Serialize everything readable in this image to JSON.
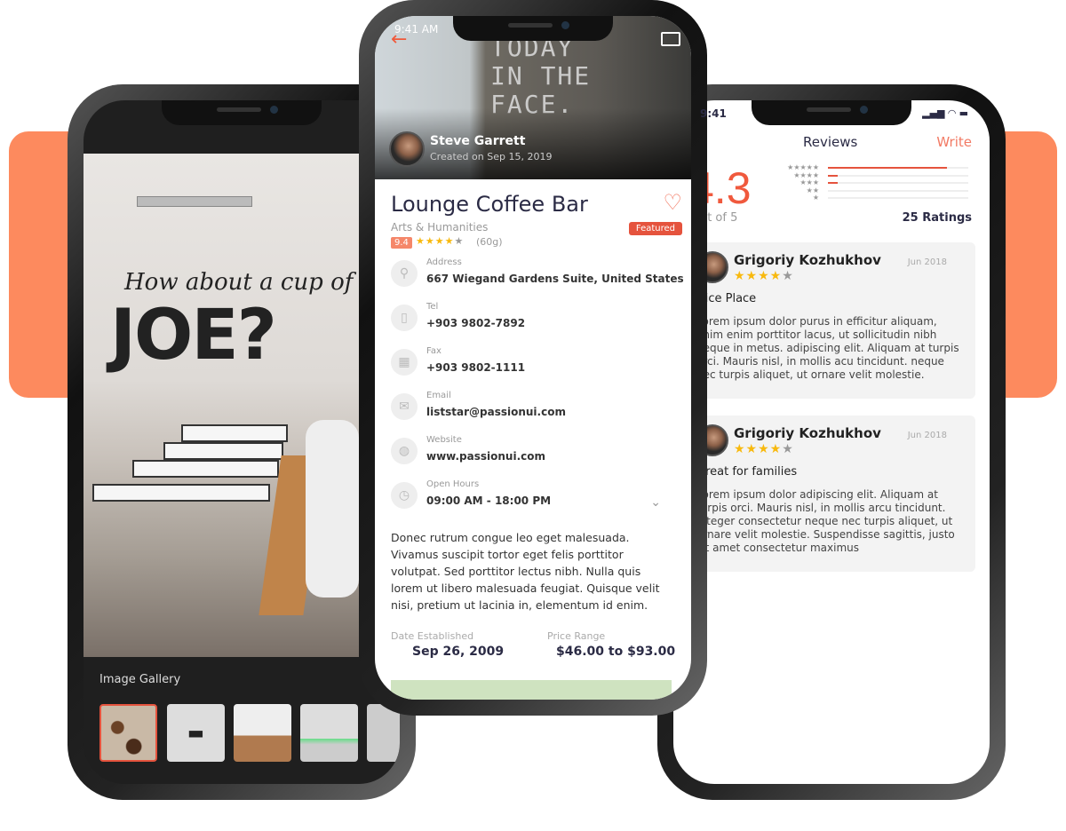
{
  "gallery_screen": {
    "sign_line1": "How about a cup of",
    "sign_line2": "JOE?",
    "gallery_title": "Image Gallery"
  },
  "detail_screen": {
    "status_time": "9:41 AM",
    "author": {
      "name": "Steve Garrett",
      "created": "Created on Sep 15, 2019"
    },
    "hero_wall_text": "TODAY\nIN THE\nFACE.",
    "title": "Lounge Coffee Bar",
    "category": "Arts & Humanities",
    "score": "9.4",
    "stars": 4,
    "reviews_count": "(60g)",
    "badge": "Featured",
    "info": [
      {
        "label": "Address",
        "value": "667 Wiegand Gardens Suite, United States",
        "icon": "location-pin-icon"
      },
      {
        "label": "Tel",
        "value": "+903 9802-7892",
        "icon": "phone-icon"
      },
      {
        "label": "Fax",
        "value": "+903 9802-1111",
        "icon": "fax-icon"
      },
      {
        "label": "Email",
        "value": "liststar@passionui.com",
        "icon": "mail-icon"
      },
      {
        "label": "Website",
        "value": "www.passionui.com",
        "icon": "globe-icon"
      },
      {
        "label": "Open Hours",
        "value": "09:00 AM - 18:00 PM",
        "icon": "clock-icon"
      }
    ],
    "description": "Donec rutrum congue leo eget malesuada. Vivamus suscipit tortor eget felis porttitor volutpat. Sed porttitor lectus nibh. Nulla quis lorem ut libero malesuada feugiat. Quisque velit nisi, pretium ut lacinia in, elementum id enim.",
    "date_established_label": "Date Established",
    "date_established": "Sep 26, 2009",
    "price_range_label": "Price Range",
    "price_range": "$46.00 to $93.00"
  },
  "reviews_screen": {
    "status_time": "9:41",
    "title": "Reviews",
    "write": "Write",
    "rating": "4.3",
    "out_of": "out of 5",
    "ratings_count": "25 Ratings",
    "distribution": [
      {
        "stars": 5,
        "fraction": 0.85
      },
      {
        "stars": 4,
        "fraction": 0.07
      },
      {
        "stars": 3,
        "fraction": 0.07
      },
      {
        "stars": 2,
        "fraction": 0
      },
      {
        "stars": 1,
        "fraction": 0
      }
    ],
    "reviews": [
      {
        "name": "Grigoriy Kozhukhov",
        "date": "Jun 2018",
        "stars": 4,
        "title": "Nice Place",
        "body": "Lorem ipsum dolor purus in efficitur aliquam, enim enim porttitor lacus, ut sollicitudin nibh neque in metus. adipiscing elit. Aliquam at turpis orci. Mauris nisl, in mollis acu  tincidunt. neque nec turpis aliquet, ut ornare velit molestie."
      },
      {
        "name": "Grigoriy Kozhukhov",
        "date": "Jun 2018",
        "stars": 4,
        "title": "Great for families",
        "body": "Lorem ipsum dolor adipiscing elit. Aliquam at turpis orci. Mauris nisl, in mollis arcu  tincidunt. Integer consectetur neque nec turpis aliquet, ut ornare velit molestie. Suspendisse sagittis, justo sit amet consectetur maximus"
      }
    ]
  },
  "colors": {
    "accent": "#e5533d",
    "band": "#fd8a5e",
    "star": "#f8b90e"
  }
}
